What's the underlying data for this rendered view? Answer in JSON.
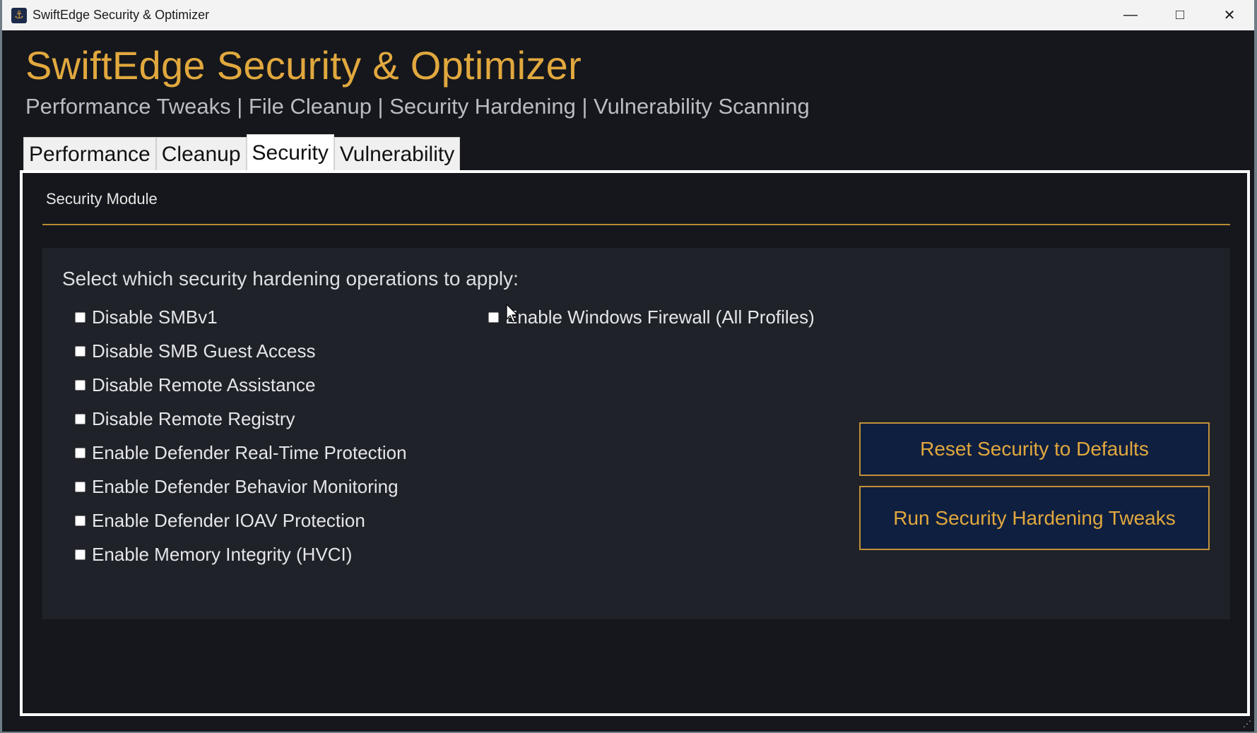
{
  "window": {
    "title": "SwiftEdge Security & Optimizer",
    "icon": "shield-app-icon",
    "controls": [
      "minimize",
      "maximize",
      "close"
    ]
  },
  "header": {
    "title": "SwiftEdge Security & Optimizer",
    "subtitle": "Performance Tweaks | File Cleanup | Security Hardening | Vulnerability Scanning"
  },
  "tabs": [
    {
      "label": "Performance",
      "active": false
    },
    {
      "label": "Cleanup",
      "active": false
    },
    {
      "label": "Security",
      "active": true
    },
    {
      "label": "Vulnerability",
      "active": false
    }
  ],
  "security": {
    "module_label": "Security Module",
    "prompt": "Select which security hardening operations to apply:",
    "options_left": [
      {
        "label": "Disable SMBv1",
        "checked": false
      },
      {
        "label": "Disable SMB Guest Access",
        "checked": false
      },
      {
        "label": "Disable Remote Assistance",
        "checked": false
      },
      {
        "label": "Disable Remote Registry",
        "checked": false
      },
      {
        "label": "Enable Defender Real-Time Protection",
        "checked": false
      },
      {
        "label": "Enable Defender Behavior Monitoring",
        "checked": false
      },
      {
        "label": "Enable Defender IOAV Protection",
        "checked": false
      },
      {
        "label": "Enable Memory Integrity (HVCI)",
        "checked": false
      }
    ],
    "options_right": [
      {
        "label": "Enable Windows Firewall (All Profiles)",
        "checked": false
      }
    ],
    "reset_button": "Reset Security to Defaults",
    "run_button": "Run Security Hardening Tweaks"
  },
  "colors": {
    "accent": "#e1a83e",
    "background": "#15171c",
    "card": "#1f2228",
    "button_bg": "#0f1f3f"
  }
}
